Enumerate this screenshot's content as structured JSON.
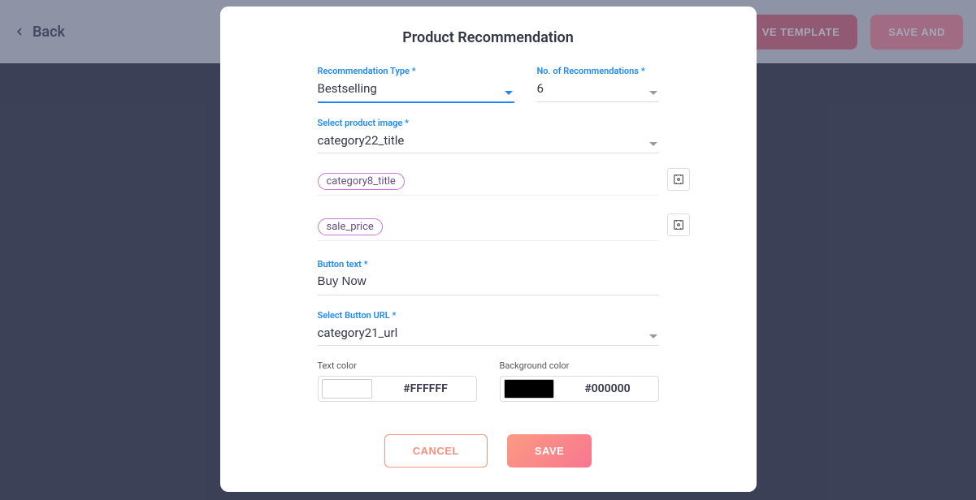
{
  "topbar": {
    "back_label": "Back",
    "save_template_label": "VE TEMPLATE",
    "save_and_label": "SAVE AND "
  },
  "modal": {
    "title": "Product Recommendation",
    "fields": {
      "rec_type": {
        "label": "Recommendation Type *",
        "value": "Bestselling"
      },
      "num_rec": {
        "label": "No. of Recommendations *",
        "value": "6"
      },
      "product_image": {
        "label": "Select product image *",
        "value": "category22_title"
      },
      "tag1": "category8_title",
      "tag2": "sale_price",
      "button_text": {
        "label": "Button text *",
        "value": "Buy Now"
      },
      "button_url": {
        "label": "Select Button URL *",
        "value": "category21_url"
      },
      "text_color": {
        "label": "Text color",
        "hex": "#FFFFFF",
        "swatch": "#FFFFFF"
      },
      "bg_color": {
        "label": "Background color",
        "hex": "#000000",
        "swatch": "#000000"
      }
    },
    "actions": {
      "cancel": "CANCEL",
      "save": "SAVE"
    }
  }
}
